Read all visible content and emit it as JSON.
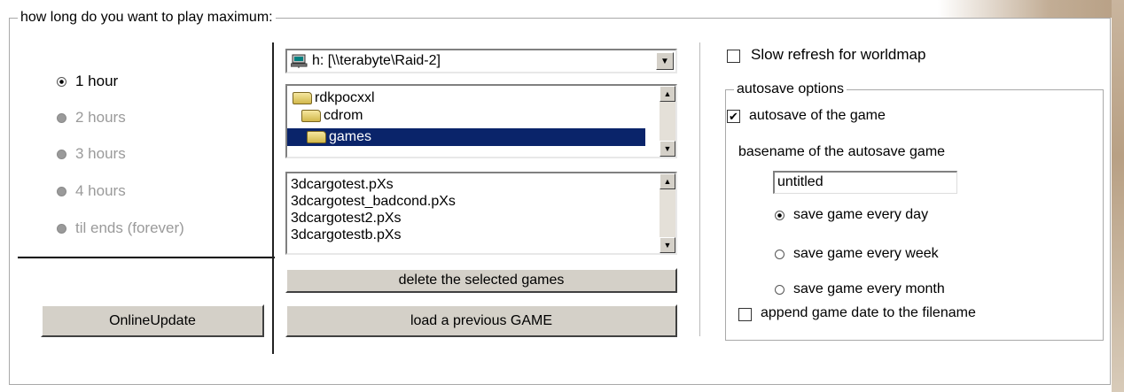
{
  "play_group": {
    "title": "how long do you want to play maximum:",
    "options": [
      {
        "label": "1 hour",
        "checked": true,
        "enabled": true
      },
      {
        "label": "2 hours",
        "checked": false,
        "enabled": false
      },
      {
        "label": "3 hours",
        "checked": false,
        "enabled": false
      },
      {
        "label": "4 hours",
        "checked": false,
        "enabled": false
      },
      {
        "label": "til ends (forever)",
        "checked": false,
        "enabled": false
      }
    ]
  },
  "online_update_label": "OnlineUpdate",
  "drive_combo": {
    "value": "h: [\\\\terabyte\\Raid-2]"
  },
  "folders": [
    {
      "name": "rdkpocxxl",
      "selected": false
    },
    {
      "name": "cdrom",
      "selected": false
    },
    {
      "name": "games",
      "selected": true
    }
  ],
  "files": [
    "3dcargotest.pXs",
    "3dcargotest_badcond.pXs",
    "3dcargotest2.pXs",
    "3dcargotestb.pXs"
  ],
  "delete_label": "delete the selected games",
  "load_label": "load a previous GAME",
  "slow_refresh": {
    "label": "Slow refresh for worldmap",
    "checked": false
  },
  "autosave": {
    "title": "autosave options",
    "autosave_checkbox": {
      "label": "autosave of the game",
      "checked": true
    },
    "basename_label": "basename of the autosave game",
    "basename_value": "untitled",
    "frequency": [
      {
        "label": "save game every day",
        "checked": true
      },
      {
        "label": "save game every week",
        "checked": false
      },
      {
        "label": "save game every month",
        "checked": false
      }
    ],
    "append_date": {
      "label": "append game date to the filename",
      "checked": false
    }
  },
  "colors": {
    "selection": "#0a246a",
    "button_face": "#d4d0c8"
  }
}
